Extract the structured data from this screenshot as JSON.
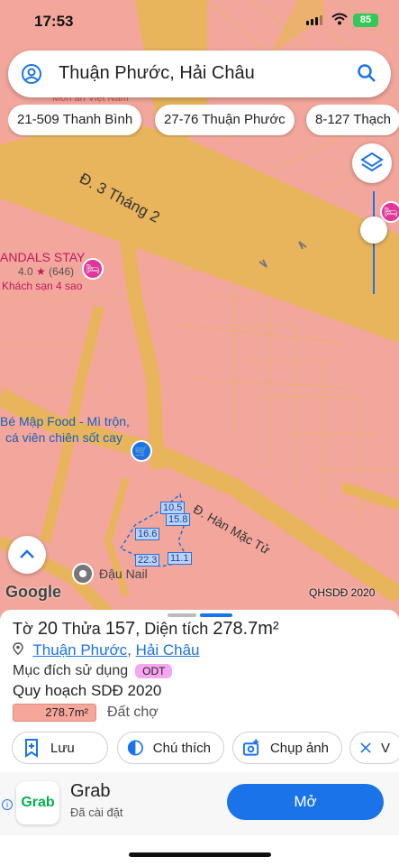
{
  "status": {
    "time": "17:53",
    "battery": "85"
  },
  "search": {
    "query": "Thuận Phước, Hải Châu"
  },
  "chips": [
    "21-509 Thanh Bình",
    "27-76 Thuận Phước",
    "8-127 Thạch"
  ],
  "map": {
    "street_main": "Đ. 3 Tháng 2",
    "street_side": "Đ. Hàn Mặc Tử",
    "hotel_name": "ANDALS STAY",
    "hotel_rating": "4.0",
    "hotel_reviews": "(646)",
    "hotel_type": "Khách sạn 4 sao",
    "top_label": "Môn ăn Việt Nam",
    "food_line1": "Bé Mập Food - Mì trộn,",
    "food_line2": "cá viên chiên sốt cay",
    "nail": "Đậu Nail",
    "google": "Google",
    "watermark": "QHSDĐ 2020",
    "plot_edges": [
      "10.5",
      "15.8",
      "16.6",
      "22.3",
      "11.1"
    ]
  },
  "sheet": {
    "title_prefix": "Tờ ",
    "sheet_no": "20",
    "title_mid": " Thửa ",
    "parcel_no": "157",
    "title_area_label": ", Diện tích ",
    "area": "278.7m²",
    "ward": "Thuận Phước",
    "district": "Hải Châu",
    "purpose_label": "Mục đích sử dụng",
    "purpose_code": "ODT",
    "plan_label": "Quy hoạch SDĐ 2020",
    "plan_area": "278.7m²",
    "plan_type": "Đất chợ",
    "actions": [
      "Lưu",
      "Chú thích",
      "Chụp ảnh",
      "V"
    ]
  },
  "ad": {
    "name": "Grab",
    "logo_text": "Grab",
    "sub": "Đã cài đặt",
    "open": "Mở",
    "info": "i"
  },
  "colors": {
    "map_base": "#f3a79c",
    "road": "#e8b45c",
    "accent": "#1a73e8",
    "hotel_pin": "#e0379a",
    "plot": "#2a6fd6"
  }
}
